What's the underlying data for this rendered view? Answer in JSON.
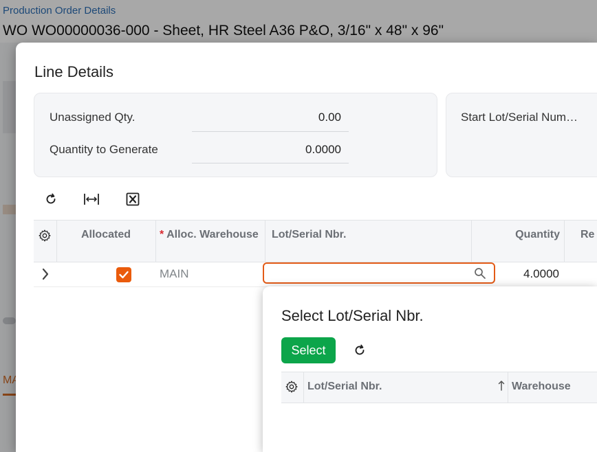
{
  "page": {
    "breadcrumb": "Production Order Details",
    "title": "WO WO00000036-000 - Sheet, HR Steel A36 P&O, 3/16\" x 48\" x 96\"",
    "background_tab_fragment": "MA"
  },
  "dialog": {
    "title": "Line Details",
    "fields": {
      "unassigned_qty_label": "Unassigned Qty.",
      "unassigned_qty_value": "0.00",
      "qty_to_generate_label": "Quantity to Generate",
      "qty_to_generate_value": "0.0000",
      "start_lot_label": "Start Lot/Serial Num…"
    },
    "toolbar": {
      "refresh_icon": "refresh-icon",
      "fit_columns_icon": "fit-columns-icon",
      "export_excel_icon": "excel-export-icon"
    },
    "grid": {
      "columns": {
        "allocated": "Allocated",
        "required_mark": "*",
        "alloc_warehouse": "Alloc. Warehouse",
        "lot_serial": "Lot/Serial Nbr.",
        "quantity": "Quantity",
        "rec_fragment": "Re"
      },
      "rows": [
        {
          "allocated": true,
          "warehouse": "MAIN",
          "lot_serial": "",
          "quantity": "4.0000"
        }
      ]
    }
  },
  "lot_popup": {
    "title": "Select Lot/Serial Nbr.",
    "select_label": "Select",
    "columns": {
      "lot_serial": "Lot/Serial Nbr.",
      "warehouse": "Warehouse"
    }
  },
  "colors": {
    "accent_orange": "#ea5b0c",
    "select_green": "#0ca54a",
    "link_blue": "#2d6fb6"
  }
}
